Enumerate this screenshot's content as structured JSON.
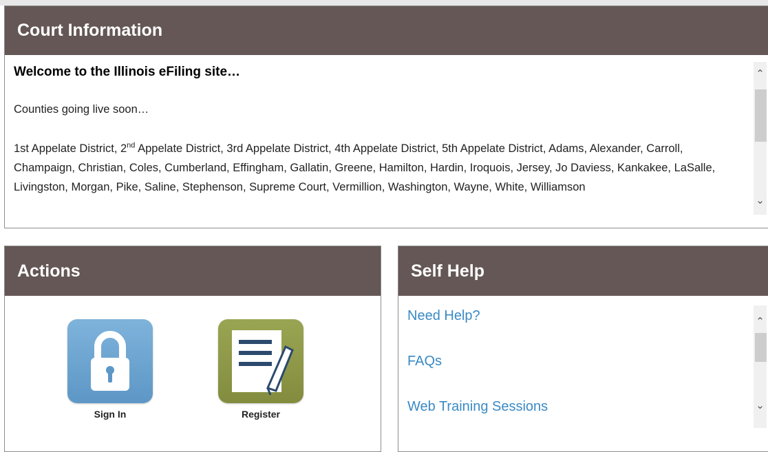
{
  "court_info": {
    "title": "Court Information",
    "welcome": "Welcome to the Illinois eFiling site…",
    "going_live": "Counties going live soon…",
    "counties_lead": "1st Appelate District, 2",
    "counties_sup": "nd",
    "counties_rest": " Appelate District, 3rd Appelate District, 4th Appelate District, 5th Appelate District, Adams, Alexander, Carroll, Champaign, Christian, Coles, Cumberland, Effingham, Gallatin, Greene, Hamilton, Hardin, Iroquois, Jersey, Jo Daviess, Kankakee, LaSalle, Livingston, Morgan, Pike, Saline, Stephenson, Supreme Court, Vermillion, Washington, Wayne, White, Williamson"
  },
  "actions": {
    "title": "Actions",
    "sign_in_label": "Sign In",
    "register_label": "Register"
  },
  "self_help": {
    "title": "Self Help",
    "links": [
      "Need Help?",
      "FAQs",
      "Web Training Sessions"
    ]
  },
  "icons": {
    "sign_in": "lock-icon",
    "register": "document-pencil-icon",
    "scroll_up": "chevron-up-icon",
    "scroll_down": "chevron-down-icon"
  },
  "colors": {
    "header_bg": "#645755",
    "link": "#3a8ac4",
    "sign_in_tile": "#6aa3d1",
    "register_tile": "#8f9a48"
  }
}
